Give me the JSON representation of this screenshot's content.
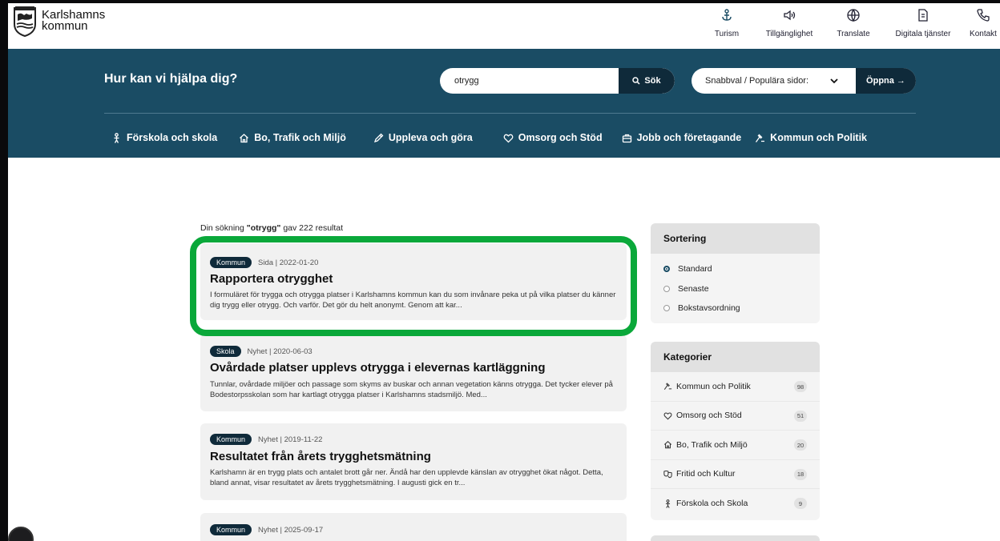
{
  "header": {
    "logo_line1": "Karlshamns",
    "logo_line2": "kommun",
    "tools": [
      {
        "label": "Turism",
        "icon": "anchor-icon"
      },
      {
        "label": "Tillgänglighet",
        "icon": "speaker-icon"
      },
      {
        "label": "Translate",
        "icon": "globe-icon"
      },
      {
        "label": "Digitala tjänster",
        "icon": "document-icon"
      },
      {
        "label": "Kontakt",
        "icon": "phone-icon"
      }
    ]
  },
  "band": {
    "title": "Hur kan vi hjälpa dig?",
    "search_value": "otrygg",
    "search_button": "Sök",
    "quick_select": "Snabbval / Populära sidor:",
    "quick_button": "Öppna →"
  },
  "nav": [
    {
      "label": "Förskola och skola",
      "icon": "child-icon"
    },
    {
      "label": "Bo, Trafik och Miljö",
      "icon": "house-icon"
    },
    {
      "label": "Uppleva och göra",
      "icon": "pen-icon"
    },
    {
      "label": "Omsorg och Stöd",
      "icon": "heart-icon"
    },
    {
      "label": "Jobb och företagande",
      "icon": "briefcase-icon"
    },
    {
      "label": "Kommun och Politik",
      "icon": "gavel-icon"
    }
  ],
  "results": {
    "summary_prefix": "Din sökning ",
    "summary_term": "\"otrygg\"",
    "summary_suffix": " gav 222 resultat",
    "items": [
      {
        "badge": "Kommun",
        "meta": "Sida | 2022-01-20",
        "title": "Rapportera otrygghet",
        "desc": "I formuläret  för trygga och otrygga platser i Karlshamns kommun kan du som invånare peka ut på vilka platser du känner dig trygg eller otrygg. Och varför. Det gör du helt anonymt. Genom att kar..."
      },
      {
        "badge": "Skola",
        "meta": "Nyhet | 2020-06-03",
        "title": "Ovårdade platser upplevs otrygga i elevernas kartläggning",
        "desc": "Tunnlar, ovårdade miljöer och passage som skyms av buskar och annan vegetation känns otrygga. Det tycker elever på Bodestorpsskolan som har kartlagt otrygga platser i Karlshamns stadsmiljö. Med..."
      },
      {
        "badge": "Kommun",
        "meta": "Nyhet | 2019-11-22",
        "title": "Resultatet från årets trygghetsmätning",
        "desc": "Karlshamn är en trygg plats och antalet brott går ner. Ändå har den upplevde känslan av otrygghet ökat något. Detta, bland annat, visar resultatet av årets trygghetsmätning. I augusti gick en tr..."
      },
      {
        "badge": "Kommun",
        "meta": "Nyhet | 2025-09-17",
        "title": "",
        "desc": ""
      }
    ]
  },
  "sorting": {
    "title": "Sortering",
    "options": [
      "Standard",
      "Senaste",
      "Bokstavsordning"
    ]
  },
  "categories": {
    "title": "Kategorier",
    "items": [
      {
        "label": "Kommun och Politik",
        "count": "98",
        "icon": "gavel-icon"
      },
      {
        "label": "Omsorg och Stöd",
        "count": "51",
        "icon": "heart-icon"
      },
      {
        "label": "Bo, Trafik och Miljö",
        "count": "20",
        "icon": "house-icon"
      },
      {
        "label": "Fritid och Kultur",
        "count": "18",
        "icon": "masks-icon"
      },
      {
        "label": "Förskola och Skola",
        "count": "9",
        "icon": "child-icon"
      }
    ]
  },
  "colors": {
    "band": "#1a4c64",
    "dark_button": "#0f2a3a",
    "highlight": "#0aa83a"
  }
}
